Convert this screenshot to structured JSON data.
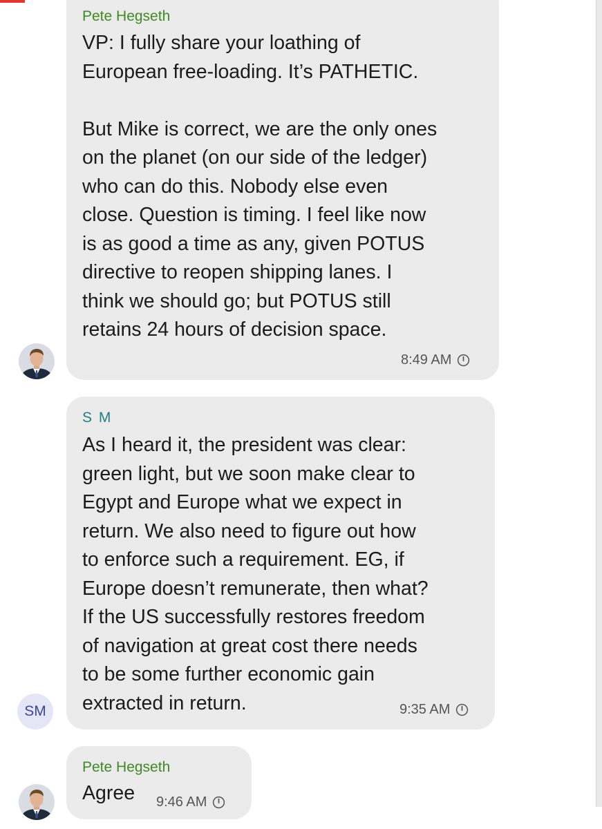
{
  "messages": [
    {
      "sender": "Pete Hegseth",
      "text": "VP: I fully share your loathing of\nEuropean free-loading. It’s PATHETIC.\n\nBut Mike is correct, we are the only ones\non the planet (on our side of the ledger)\nwho can do this. Nobody else even\nclose. Question is timing. I feel like now\nis as good a time as any, given POTUS\ndirective to reopen shipping lanes. I\nthink we should go; but POTUS still\nretains 24 hours of decision space.",
      "time": "8:49 AM",
      "timer_icon": "disappearing-timer-icon",
      "avatar": "profile-photo"
    },
    {
      "sender": "S M",
      "text": "As I heard it, the president was clear:\ngreen light, but we soon make clear to\nEgypt and Europe what we expect in\nreturn. We also need to figure out how\nto enforce such a requirement. EG, if\nEurope doesn’t remunerate, then what?\nIf the US successfully restores freedom\nof navigation at great cost there needs\nto be some further economic gain\nextracted in return.",
      "time": "9:35 AM",
      "timer_icon": "disappearing-timer-icon",
      "avatar_initials": "SM"
    },
    {
      "sender": "Pete Hegseth",
      "text": "Agree",
      "time": "9:46 AM",
      "timer_icon": "disappearing-timer-icon",
      "avatar": "profile-photo"
    }
  ],
  "colors": {
    "bubble": "#ebebeb",
    "sender_green": "#3f8a22",
    "sender_teal": "#227f80",
    "initials_bg": "#e4e6f6",
    "initials_fg": "#3a4799"
  }
}
